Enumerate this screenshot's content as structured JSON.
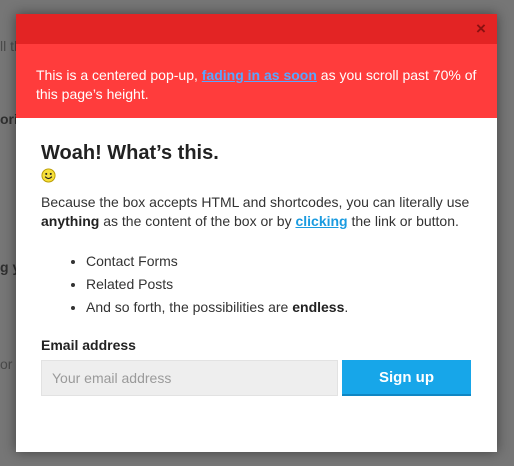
{
  "background": {
    "fragments": [
      "ll tl",
      "ori",
      "g y",
      "or a"
    ]
  },
  "modal": {
    "close_label": "×",
    "banner": {
      "text_before": "This is a centered pop-up, ",
      "link_text": "fading in as soon",
      "text_after": " as you scroll past 70% of this page’s height."
    },
    "headline": "Woah! What’s this.",
    "emoji": "smiley-icon",
    "paragraph": {
      "part1": "Because the box accepts HTML and shortcodes, you can literally use ",
      "bold": "anything",
      "part2": " as the content of the box or by ",
      "link": "clicking",
      "part3": " the link or button."
    },
    "list": {
      "item1": "Contact Forms",
      "item2": "Related Posts",
      "item3_prefix": "And so forth, the possibilities are ",
      "item3_bold": "endless",
      "item3_suffix": "."
    },
    "form": {
      "label": "Email address",
      "placeholder": "Your email address",
      "button_label": "Sign up"
    }
  },
  "colors": {
    "top_strip": "#e32424",
    "banner": "#ff3c3c",
    "button": "#17a6e9",
    "link": "#1a9be0"
  }
}
